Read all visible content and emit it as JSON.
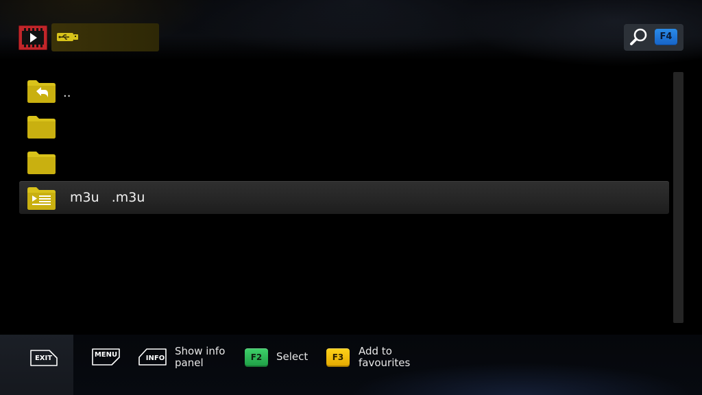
{
  "header": {
    "logo_icon": "movie-clapper-play-icon",
    "path_icon": "usb-drive-icon",
    "search": {
      "icon": "search-icon",
      "key_label": "F4",
      "key_color": "#1e73d6"
    }
  },
  "file_list": {
    "items": [
      {
        "type": "parent",
        "icon": "folder-back-icon",
        "label": ".."
      },
      {
        "type": "folder",
        "icon": "folder-icon",
        "label": ""
      },
      {
        "type": "folder",
        "icon": "folder-icon",
        "label": ""
      },
      {
        "type": "playlist",
        "icon": "playlist-folder-icon",
        "label": "m3u   .m3u",
        "selected": true
      }
    ],
    "accent_color": "#d9c21a"
  },
  "bottom_bar": {
    "exit": {
      "key_label": "EXIT"
    },
    "menu": {
      "key_label": "MENU"
    },
    "info": {
      "key_label": "INFO",
      "hint": "Show info panel"
    },
    "select": {
      "key_label": "F2",
      "hint": "Select",
      "color": "#2fb555"
    },
    "favourites": {
      "key_label": "F3",
      "hint": "Add to favourites",
      "color": "#f3c100"
    }
  }
}
